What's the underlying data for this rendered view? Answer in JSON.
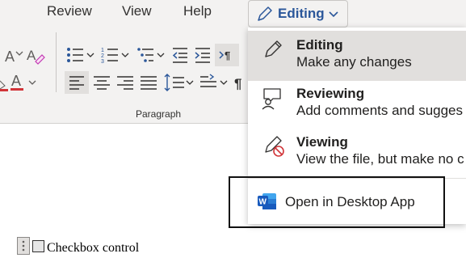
{
  "ribbon": {
    "tabs": [
      "Review",
      "View",
      "Help"
    ],
    "group_label": "Paragraph"
  },
  "mode_button": {
    "label": "Editing"
  },
  "mode_menu": {
    "items": [
      {
        "title": "Editing",
        "description": "Make any changes",
        "icon": "pencil-icon",
        "selected": true
      },
      {
        "title": "Reviewing",
        "description": "Add comments and sugges",
        "icon": "reviewing-icon",
        "selected": false
      },
      {
        "title": "Viewing",
        "description": "View the file, but make no c",
        "icon": "viewing-icon",
        "selected": false
      }
    ],
    "desktop_app": {
      "label": "Open in Desktop App",
      "icon": "word-icon"
    }
  },
  "document": {
    "checkbox_label": "Checkbox control"
  },
  "colors": {
    "accent": "#2b579a",
    "ribbon_bg": "#f3f2f1",
    "selected_bg": "#e1dfdd",
    "font_color_red": "#d13438"
  }
}
